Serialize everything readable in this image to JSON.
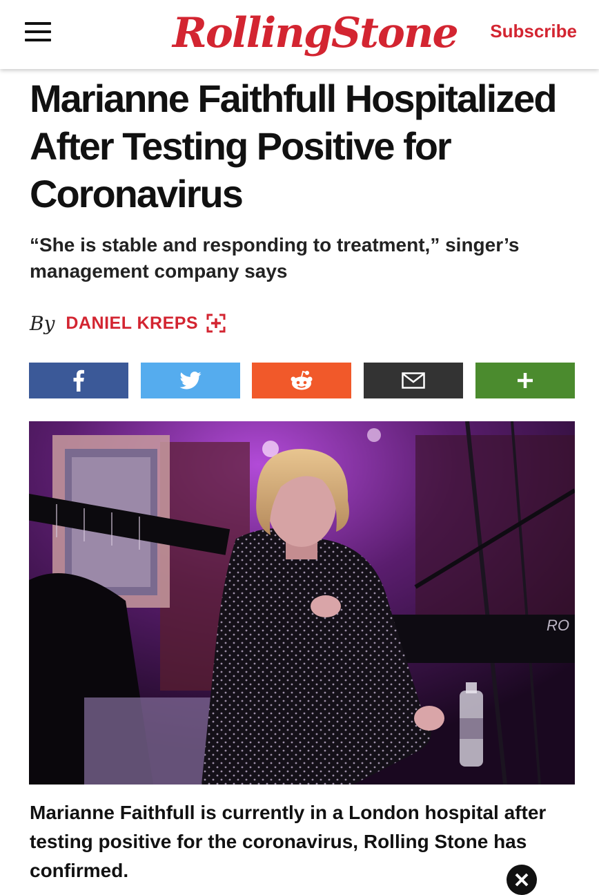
{
  "header": {
    "logo_text": "RollingStone",
    "subscribe_label": "Subscribe",
    "menu_icon": "hamburger-menu-icon",
    "brand_color": "#d32531"
  },
  "article": {
    "headline": "Marianne Faithfull Hospitalized After Testing Positive for Coronavirus",
    "dek": "“She is stable and responding to treatment,” singer’s management company says",
    "byline_prefix": "By",
    "author": "DANIEL KREPS",
    "body": "Marianne Faithfull is currently in a London hospital after testing positive for the coronavirus, Rolling Stone has confirmed."
  },
  "share": {
    "buttons": [
      {
        "icon": "facebook-icon",
        "color": "#3b5998"
      },
      {
        "icon": "twitter-icon",
        "color": "#55acee"
      },
      {
        "icon": "reddit-icon",
        "color": "#f1592a"
      },
      {
        "icon": "email-icon",
        "color": "#333333"
      },
      {
        "icon": "plus-icon",
        "color": "#4b8b2e"
      }
    ]
  },
  "hero_image": {
    "keyboard_text": "RO"
  }
}
